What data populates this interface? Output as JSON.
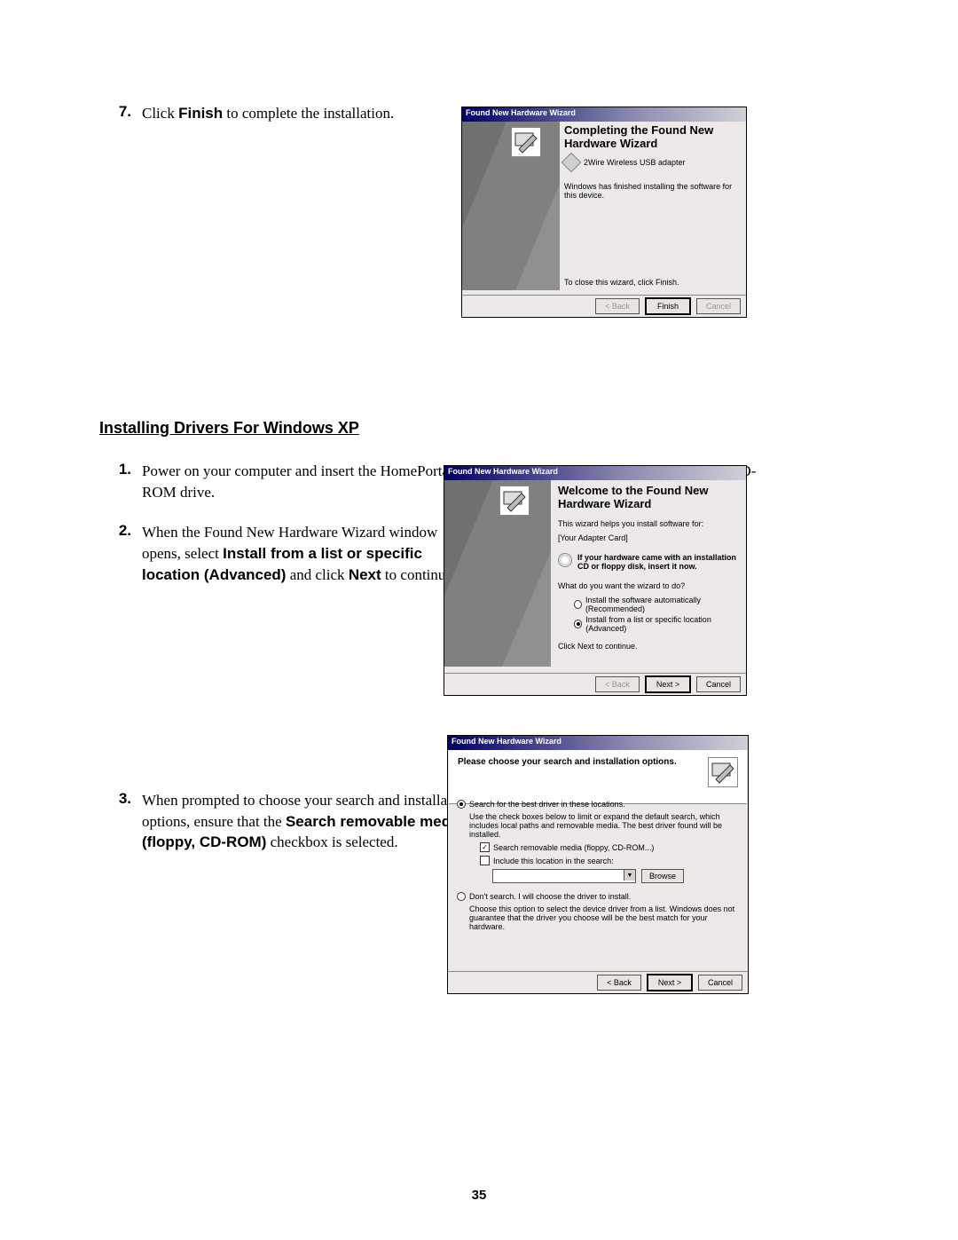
{
  "page_number": "35",
  "step7": {
    "num": "7.",
    "prefix": "Click ",
    "bold": "Finish",
    "suffix": " to complete the installation."
  },
  "section_title": "Installing Drivers For Windows XP",
  "step1": {
    "num": "1.",
    "text": "Power on your computer and insert the HomePortal Setup Wizard for Windows XP CD into your CD-ROM drive."
  },
  "step2": {
    "num": "2.",
    "a": "When the Found New Hardware Wizard window opens, select ",
    "b": "Install from a list or specific location (Advanced)",
    "c": " and click ",
    "d": "Next",
    "e": " to continue."
  },
  "step3": {
    "num": "3.",
    "a": "When prompted to choose your search and installation options, ensure that the ",
    "b": "Search removable media (floppy, CD-ROM)",
    "c": " checkbox is selected."
  },
  "dlg_title": "Found New Hardware Wizard",
  "dlg1": {
    "heading": "Completing the Found New Hardware Wizard",
    "device": "2Wire Wireless USB adapter",
    "done": "Windows has finished installing the software for this device.",
    "close": "To close this wizard, click Finish.",
    "back": "< Back",
    "finish": "Finish",
    "cancel": "Cancel"
  },
  "dlg2": {
    "heading": "Welcome to the Found New Hardware Wizard",
    "help": "This wizard helps you install software for:",
    "card": "[Your Adapter Card]",
    "cd": "If your hardware came with an installation CD or floppy disk, insert it now.",
    "q": "What do you want the wizard to do?",
    "opt1": "Install the software automatically (Recommended)",
    "opt2": "Install from a list or specific location (Advanced)",
    "cont": "Click Next to continue.",
    "back": "< Back",
    "next": "Next >",
    "cancel": "Cancel"
  },
  "dlg3": {
    "hdr": "Please choose your search and installation options.",
    "opt_search": "Search for the best driver in these locations.",
    "use": "Use the check boxes below to limit or expand the default search, which includes local paths and removable media. The best driver found will be installed.",
    "chk_media": "Search removable media (floppy, CD-ROM...)",
    "chk_loc": "Include this location in the search:",
    "browse": "Browse",
    "opt_dont": "Don't search. I will choose the driver to install.",
    "dont_txt": "Choose this option to select the device driver from a list.  Windows does not guarantee that the driver you choose will be the best match for your hardware.",
    "back": "< Back",
    "next": "Next >",
    "cancel": "Cancel"
  }
}
